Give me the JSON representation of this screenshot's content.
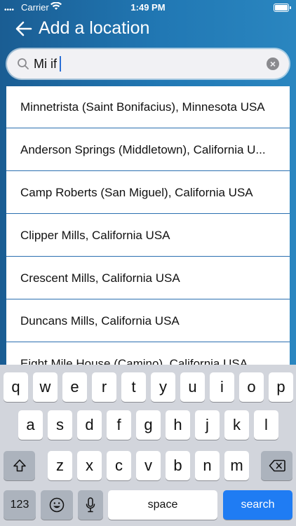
{
  "status_bar": {
    "carrier": "Carrier",
    "time": "1:49 PM"
  },
  "header": {
    "title": "Add a location",
    "back_icon": "arrow-left-icon"
  },
  "search": {
    "value": "Mi if",
    "clear_icon": "clear-icon"
  },
  "results": [
    "Minnetrista (Saint Bonifacius), Minnesota USA",
    "Anderson Springs (Middletown), California U...",
    "Camp Roberts (San Miguel), California USA",
    "Clipper Mills, California USA",
    "Crescent Mills, California USA",
    "Duncans Mills, California USA",
    "Eight Mile House (Camino), California USA"
  ],
  "keyboard": {
    "row1": [
      "q",
      "w",
      "e",
      "r",
      "t",
      "y",
      "u",
      "i",
      "o",
      "p"
    ],
    "row2": [
      "a",
      "s",
      "d",
      "f",
      "g",
      "h",
      "j",
      "k",
      "l"
    ],
    "row3": [
      "z",
      "x",
      "c",
      "v",
      "b",
      "n",
      "m"
    ],
    "numbers_label": "123",
    "space_label": "space",
    "search_label": "search"
  }
}
